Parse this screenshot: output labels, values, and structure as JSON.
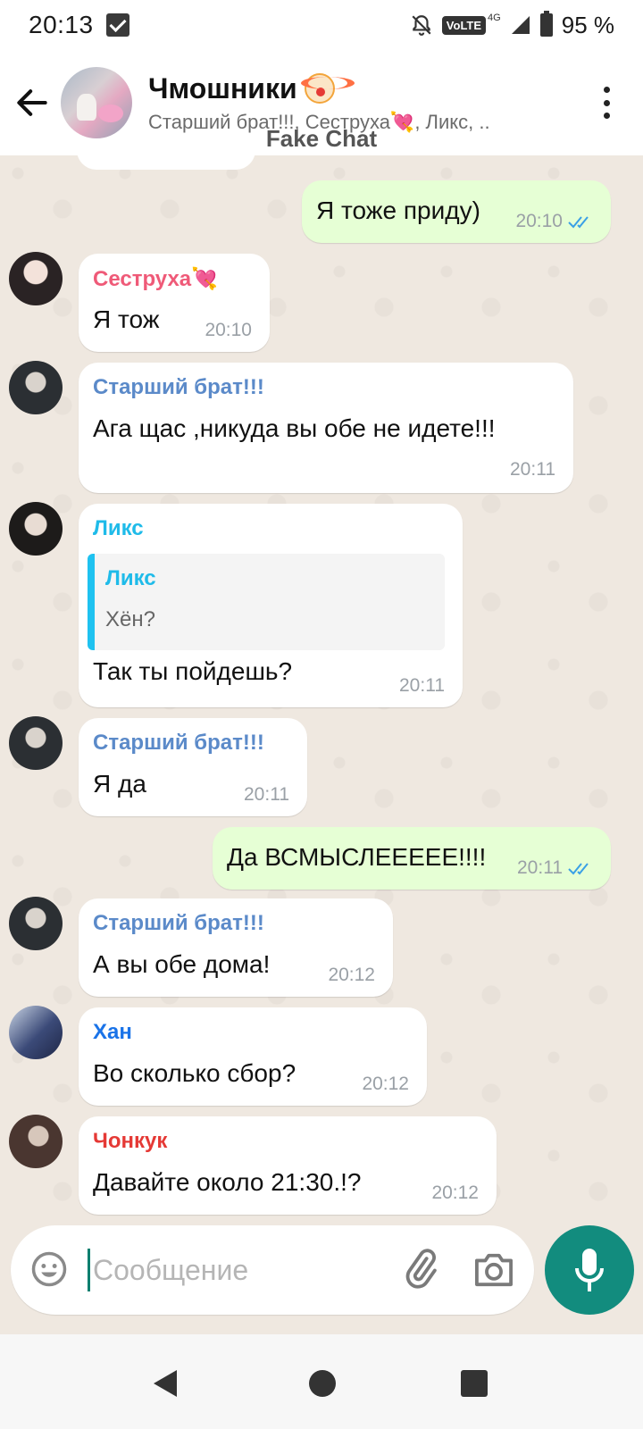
{
  "status": {
    "time": "20:13",
    "network": "4G",
    "volte": "VoLTE",
    "battery": "95 %"
  },
  "header": {
    "title": "Чмошники",
    "subtitle": "Старший брат!!!, Сеструха💘, Ликс, ..",
    "watermark": "Fake Chat"
  },
  "colors": {
    "sister": "#ef5a78",
    "brother": "#5b8ac9",
    "lix": "#1fbbe9",
    "han": "#1a73e8",
    "jungkook": "#e53935",
    "outgoing_bubble": "#e6ffd5",
    "tick_blue": "#3aa0e6",
    "accent": "#128c7e"
  },
  "messages": [
    {
      "id": "m1",
      "type": "out",
      "text": "Я тоже приду)",
      "time": "20:10",
      "status": "read"
    },
    {
      "id": "m2",
      "type": "in",
      "sender": "Сеструха💘",
      "text": "Я тож",
      "time": "20:10"
    },
    {
      "id": "m3",
      "type": "in",
      "sender": "Старший брат!!!",
      "text": "Ага щас ,никуда вы обе не идете!!!",
      "time": "20:11"
    },
    {
      "id": "m4",
      "type": "in",
      "sender": "Ликс",
      "reply": {
        "name": "Ликс",
        "text": "Хён?"
      },
      "text": "Так ты пойдешь?",
      "time": "20:11"
    },
    {
      "id": "m5",
      "type": "in",
      "sender": "Старший брат!!!",
      "text": "Я да",
      "time": "20:11"
    },
    {
      "id": "m6",
      "type": "out",
      "text": "Да ВСМЫСЛЕЕЕЕЕ!!!!",
      "time": "20:11",
      "status": "read"
    },
    {
      "id": "m7",
      "type": "in",
      "sender": "Старший брат!!!",
      "text": "А вы обе дома!",
      "time": "20:12"
    },
    {
      "id": "m8",
      "type": "in",
      "sender": "Хан",
      "text": "Во сколько сбор?",
      "time": "20:12"
    },
    {
      "id": "m9",
      "type": "in",
      "sender": "Чонкук",
      "text": "Давайте около 21:30.!?",
      "time": "20:12"
    }
  ],
  "input": {
    "placeholder": "Сообщение"
  },
  "icons": {
    "back": "arrow-left-icon",
    "menu": "more-vertical-icon",
    "emoji": "emoji-icon",
    "attach": "paperclip-icon",
    "camera": "camera-icon",
    "mic": "microphone-icon"
  }
}
